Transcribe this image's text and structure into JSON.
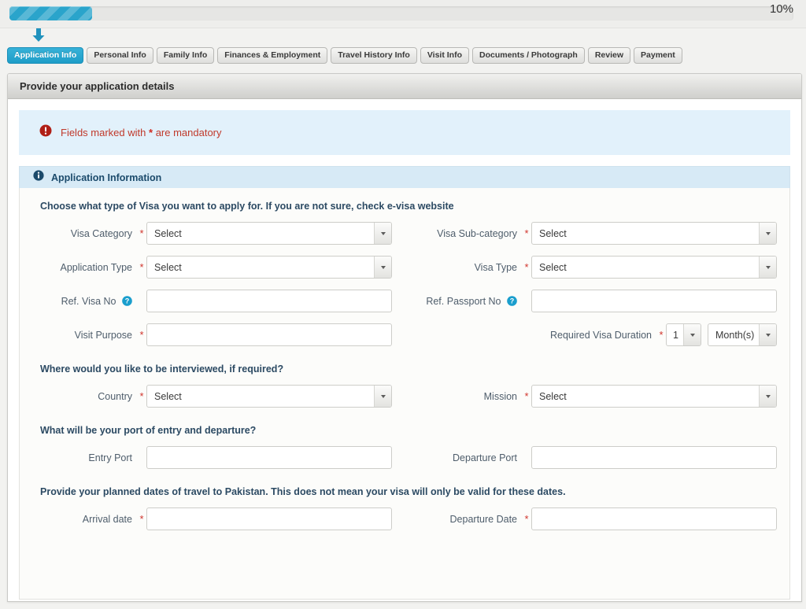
{
  "progress": {
    "percent_label": "10%",
    "percent_value": 10,
    "fill_color": "#2aa4cb"
  },
  "tabs": [
    {
      "label": "Application Info",
      "active": true
    },
    {
      "label": "Personal Info",
      "active": false
    },
    {
      "label": "Family Info",
      "active": false
    },
    {
      "label": "Finances & Employment",
      "active": false
    },
    {
      "label": "Travel History Info",
      "active": false
    },
    {
      "label": "Visit Info",
      "active": false
    },
    {
      "label": "Documents / Photograph",
      "active": false
    },
    {
      "label": "Review",
      "active": false
    },
    {
      "label": "Payment",
      "active": false
    }
  ],
  "panel": {
    "header": "Provide your application details"
  },
  "notice": {
    "icon": "error-circle-icon",
    "text_before": "Fields marked with",
    "star": "*",
    "text_after": "are mandatory",
    "color": "#c0392b",
    "background": "#e2f1fb"
  },
  "section": {
    "icon": "info-circle-icon",
    "title": "Application Information",
    "background": "#d7eaf6"
  },
  "groups": {
    "visa_type": "Choose what type of Visa you want to apply for. If you are not sure, check e-visa website",
    "interview": "Where would you like to be interviewed, if required?",
    "ports": "What will be your port of entry and departure?",
    "dates": "Provide your planned dates of travel to Pakistan. This does not mean your visa will only be valid for these dates."
  },
  "fields": {
    "visa_category": {
      "label": "Visa Category",
      "required": true,
      "type": "select",
      "value": "Select"
    },
    "visa_subcategory": {
      "label": "Visa Sub-category",
      "required": true,
      "type": "select",
      "value": "Select"
    },
    "application_type": {
      "label": "Application Type",
      "required": true,
      "type": "select",
      "value": "Select"
    },
    "visa_type": {
      "label": "Visa Type",
      "required": true,
      "type": "select",
      "value": "Select"
    },
    "ref_visa_no": {
      "label": "Ref. Visa No",
      "required": false,
      "type": "text",
      "value": "",
      "help": true
    },
    "ref_passport_no": {
      "label": "Ref. Passport No",
      "required": false,
      "type": "text",
      "value": "",
      "help": true
    },
    "visit_purpose": {
      "label": "Visit Purpose",
      "required": true,
      "type": "text",
      "value": ""
    },
    "visa_duration": {
      "label": "Required Visa Duration",
      "required": true,
      "type": "duration",
      "number_value": "1",
      "unit_value": "Month(s)"
    },
    "country": {
      "label": "Country",
      "required": true,
      "type": "select",
      "value": "Select"
    },
    "mission": {
      "label": "Mission",
      "required": true,
      "type": "select",
      "value": "Select"
    },
    "entry_port": {
      "label": "Entry Port",
      "required": false,
      "type": "text",
      "value": ""
    },
    "departure_port": {
      "label": "Departure Port",
      "required": false,
      "type": "text",
      "value": ""
    },
    "arrival_date": {
      "label": "Arrival date",
      "required": true,
      "type": "text",
      "value": ""
    },
    "departure_date": {
      "label": "Departure Date",
      "required": true,
      "type": "text",
      "value": ""
    }
  }
}
